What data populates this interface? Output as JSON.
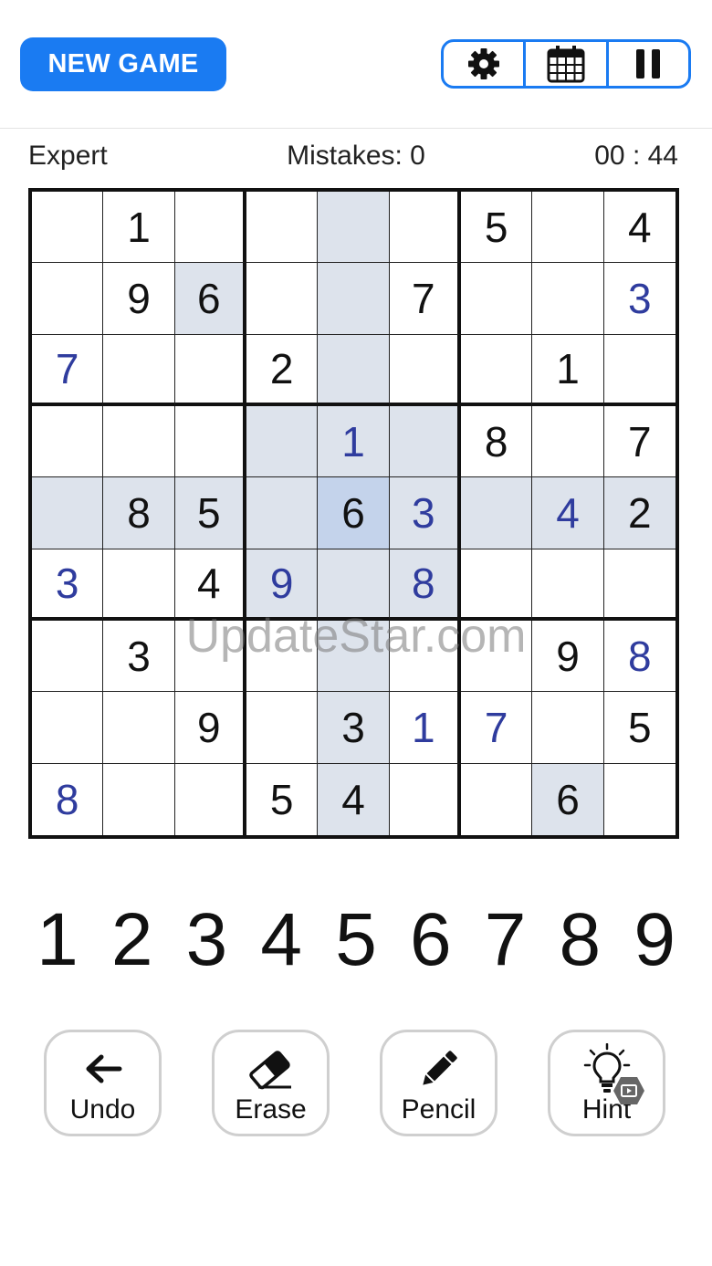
{
  "header": {
    "new_game_label": "NEW GAME",
    "buttons": [
      {
        "name": "settings",
        "icon": "gear-icon"
      },
      {
        "name": "calendar",
        "icon": "calendar-icon"
      },
      {
        "name": "pause",
        "icon": "pause-icon"
      }
    ],
    "accent_color": "#1a7bf2"
  },
  "status": {
    "difficulty": "Expert",
    "mistakes": "Mistakes: 0",
    "timer": "00 : 44"
  },
  "board": {
    "selected": [
      4,
      4
    ],
    "cells": [
      [
        "",
        "1",
        "",
        "",
        "",
        "",
        "5",
        "",
        "4"
      ],
      [
        "",
        "9",
        "6",
        "",
        "",
        "7",
        "",
        "",
        "3"
      ],
      [
        "7",
        "",
        "",
        "2",
        "",
        "",
        "",
        "1",
        ""
      ],
      [
        "",
        "",
        "",
        "",
        "1",
        "",
        "8",
        "",
        "7"
      ],
      [
        "",
        "8",
        "5",
        "",
        "6",
        "3",
        "",
        "4",
        "2"
      ],
      [
        "3",
        "",
        "4",
        "9",
        "",
        "8",
        "",
        "",
        ""
      ],
      [
        "",
        "3",
        "",
        "",
        "",
        "",
        "",
        "9",
        "8"
      ],
      [
        "",
        "",
        "9",
        "",
        "3",
        "1",
        "7",
        "",
        "5"
      ],
      [
        "8",
        "",
        "",
        "5",
        "4",
        "",
        "",
        "6",
        ""
      ]
    ],
    "user_entered": [
      [
        1,
        8
      ],
      [
        2,
        0
      ],
      [
        3,
        4
      ],
      [
        4,
        5
      ],
      [
        4,
        7
      ],
      [
        5,
        0
      ],
      [
        5,
        3
      ],
      [
        5,
        5
      ],
      [
        6,
        8
      ],
      [
        7,
        5
      ],
      [
        7,
        6
      ],
      [
        8,
        0
      ]
    ],
    "highlighted": [
      [
        0,
        4
      ],
      [
        1,
        2
      ],
      [
        1,
        4
      ],
      [
        2,
        4
      ],
      [
        3,
        3
      ],
      [
        3,
        4
      ],
      [
        3,
        5
      ],
      [
        4,
        0
      ],
      [
        4,
        1
      ],
      [
        4,
        2
      ],
      [
        4,
        3
      ],
      [
        4,
        5
      ],
      [
        4,
        6
      ],
      [
        4,
        7
      ],
      [
        4,
        8
      ],
      [
        5,
        3
      ],
      [
        5,
        4
      ],
      [
        5,
        5
      ],
      [
        6,
        4
      ],
      [
        7,
        4
      ],
      [
        8,
        4
      ],
      [
        8,
        7
      ]
    ],
    "user_digit_color": "#2f3c9e",
    "highlight_color": "#dde3ec",
    "selected_color": "#c4d3eb"
  },
  "watermark": "UpdateStar.com",
  "numpad": [
    "1",
    "2",
    "3",
    "4",
    "5",
    "6",
    "7",
    "8",
    "9"
  ],
  "tools": [
    {
      "label": "Undo",
      "icon": "undo-arrow-icon"
    },
    {
      "label": "Erase",
      "icon": "eraser-icon"
    },
    {
      "label": "Pencil",
      "icon": "pencil-icon"
    },
    {
      "label": "Hint",
      "icon": "lightbulb-icon"
    }
  ]
}
